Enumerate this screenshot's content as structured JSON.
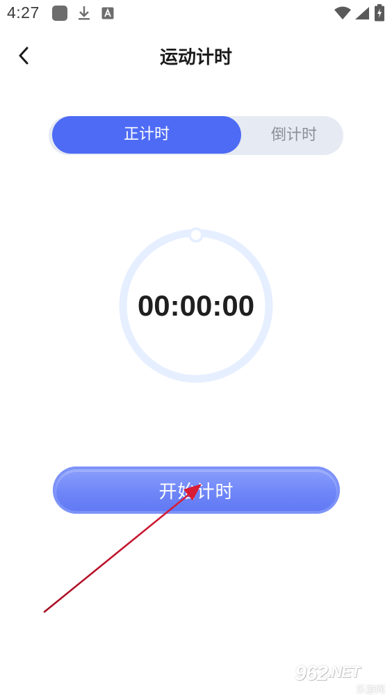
{
  "status_bar": {
    "time": "4:27",
    "icons": [
      "app-square-icon",
      "download-icon",
      "a-letter-icon",
      "wifi-icon",
      "signal-icon",
      "battery-charging-icon"
    ]
  },
  "header": {
    "back_icon": "chevron-left-icon",
    "title": "运动计时"
  },
  "mode_tabs": {
    "selected": "正计时",
    "tabs": [
      {
        "label": "正计时",
        "active": true
      },
      {
        "label": "倒计时",
        "active": false
      }
    ]
  },
  "timer": {
    "value": "00:00:00"
  },
  "start_button": {
    "label": "开始计时"
  },
  "watermark": {
    "main": "962",
    "suffix": ".NET",
    "sub": "乐游网"
  },
  "colors": {
    "accent": "#4e6bf5",
    "button_gradient_top": "#8da1fb",
    "button_gradient_bottom": "#5f77f3",
    "tab_track": "#e6eaf2",
    "ring": "#e6efff",
    "annotation_arrow": "#c8102e"
  }
}
